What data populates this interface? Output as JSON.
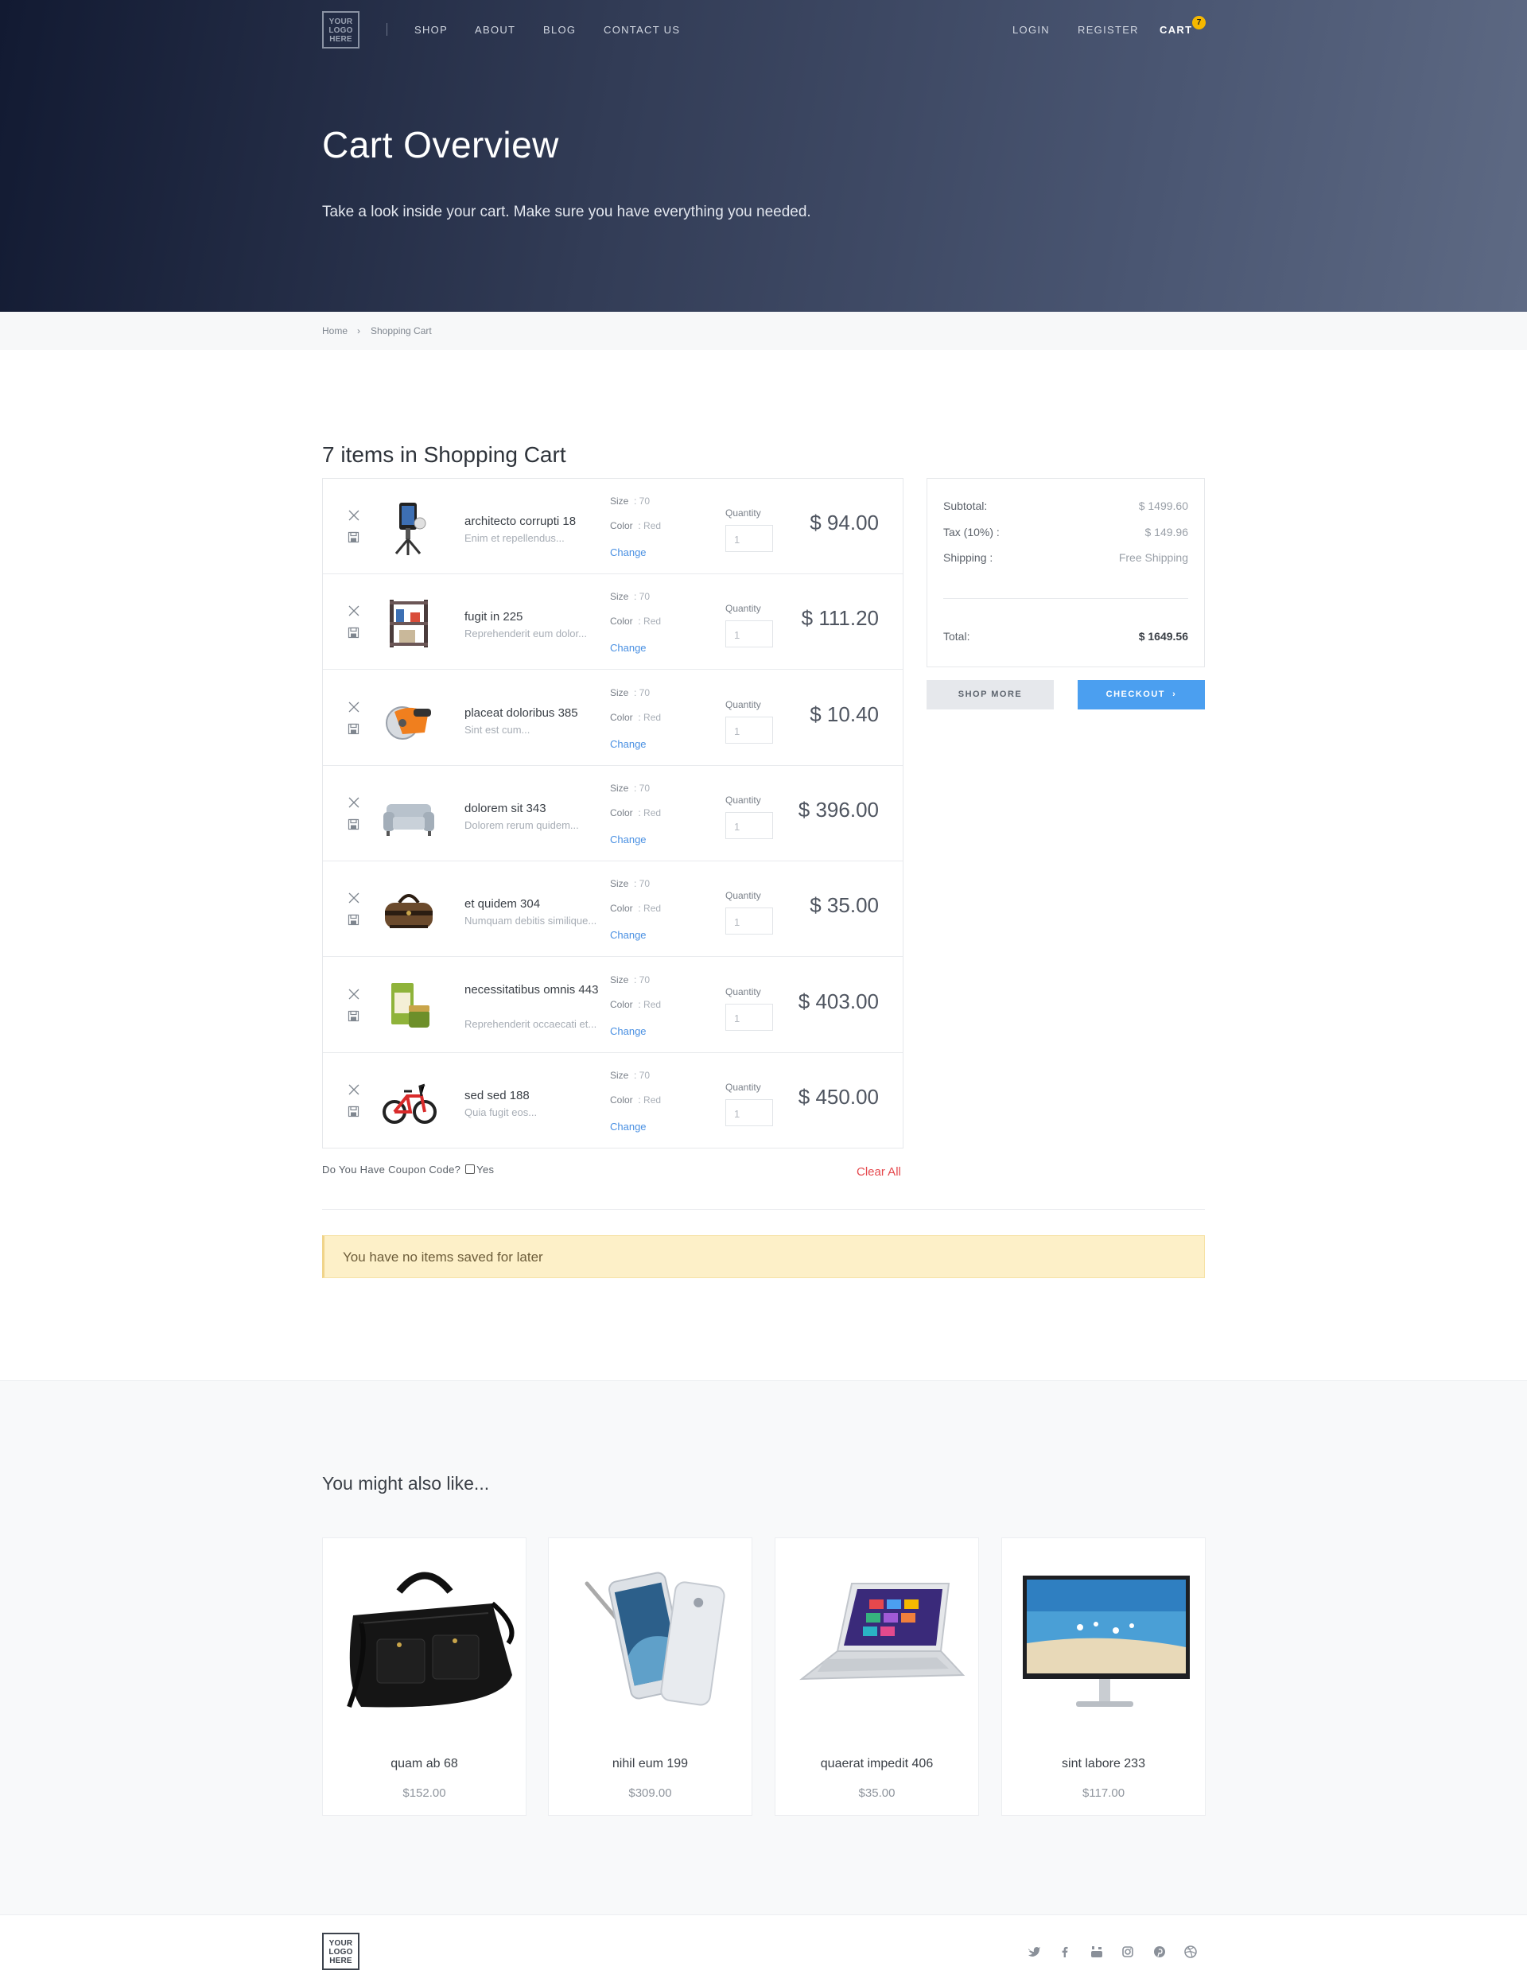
{
  "logo_text": [
    "YOUR",
    "LOGO",
    "HERE"
  ],
  "nav": {
    "left": [
      "SHOP",
      "ABOUT",
      "BLOG",
      "CONTACT US"
    ],
    "right": [
      "LOGIN",
      "REGISTER",
      "CART"
    ],
    "cart_count": "7"
  },
  "hero": {
    "title": "Cart Overview",
    "subtitle": "Take a look inside your cart. Make sure you have everything you needed."
  },
  "breadcrumb": [
    "Home",
    "›",
    "Shopping Cart"
  ],
  "cart": {
    "title": "7 items in Shopping Cart",
    "size_label": "Size",
    "color_label": "Color",
    "quantity_label": "Quantity",
    "change_label": "Change",
    "items": [
      {
        "name": "architecto corrupti 18",
        "desc": "Enim et repellendus...",
        "size": ": 70",
        "color": ": Red",
        "qty": "1",
        "price": "$ 94.00",
        "icon": "camera-stabilizer"
      },
      {
        "name": "fugit in 225",
        "desc": "Reprehenderit eum dolor...",
        "size": ": 70",
        "color": ": Red",
        "qty": "1",
        "price": "$ 111.20",
        "icon": "shelf"
      },
      {
        "name": "placeat doloribus 385",
        "desc": "Sint est cum...",
        "size": ": 70",
        "color": ": Red",
        "qty": "1",
        "price": "$ 10.40",
        "icon": "circular-saw"
      },
      {
        "name": "dolorem sit 343",
        "desc": "Dolorem rerum quidem...",
        "size": ": 70",
        "color": ": Red",
        "qty": "1",
        "price": "$ 396.00",
        "icon": "sofa"
      },
      {
        "name": "et quidem 304",
        "desc": "Numquam debitis similique...",
        "size": ": 70",
        "color": ": Red",
        "qty": "1",
        "price": "$ 35.00",
        "icon": "duffel-bag"
      },
      {
        "name": "necessitatibus omnis 443",
        "desc": "Reprehenderit occaecati et...",
        "size": ": 70",
        "color": ": Red",
        "qty": "1",
        "price": "$ 403.00",
        "icon": "cosmetic-jar"
      },
      {
        "name": "sed sed 188",
        "desc": "Quia fugit eos...",
        "size": ": 70",
        "color": ": Red",
        "qty": "1",
        "price": "$ 450.00",
        "icon": "kids-bike"
      }
    ],
    "coupon_question": "Do You Have Coupon Code?",
    "coupon_yes": "Yes",
    "clear_all": "Clear All",
    "saved_message": "You have no items saved for later"
  },
  "summary": {
    "subtotal_label": "Subtotal:",
    "subtotal": "$ 1499.60",
    "tax_label": "Tax (10%) :",
    "tax": "$ 149.96",
    "shipping_label": "Shipping :",
    "shipping": "Free Shipping",
    "total_label": "Total:",
    "total": "$ 1649.56",
    "shop_more": "SHOP MORE",
    "checkout": "CHECKOUT"
  },
  "recommendations": {
    "title": "You might also like...",
    "items": [
      {
        "name": "quam ab 68",
        "price": "$152.00",
        "icon": "leather-briefcase"
      },
      {
        "name": "nihil eum 199",
        "price": "$309.00",
        "icon": "smartphone"
      },
      {
        "name": "quaerat impedit 406",
        "price": "$35.00",
        "icon": "laptop"
      },
      {
        "name": "sint labore 233",
        "price": "$117.00",
        "icon": "monitor"
      }
    ]
  },
  "footer": {
    "social": [
      "twitter-icon",
      "facebook-icon",
      "youtube-icon",
      "instagram-icon",
      "pinterest-icon",
      "dribbble-icon"
    ]
  },
  "colors": {
    "accent": "#4b9ff0",
    "badge": "#f5b800",
    "clear": "#e5484d",
    "notice": "#fdf0c8"
  }
}
